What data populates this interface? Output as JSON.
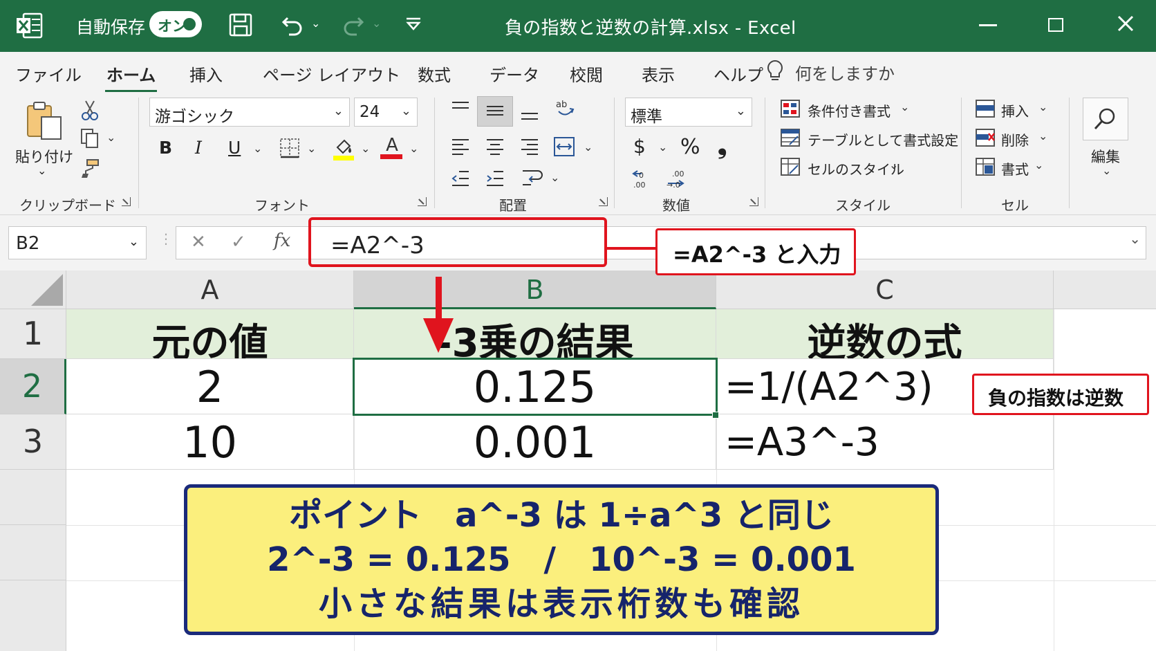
{
  "titlebar": {
    "autosave_label": "自動保存",
    "autosave_state": "オン",
    "document_title": "負の指数と逆数の計算.xlsx  -  Excel",
    "bg_color": "#1f6e43"
  },
  "menu": {
    "tabs": [
      "ファイル",
      "ホーム",
      "挿入",
      "ページ レイアウト",
      "数式",
      "データ",
      "校閲",
      "表示",
      "ヘルプ"
    ],
    "active_tab": "ホーム",
    "tell_me": "何をしますか"
  },
  "ribbon": {
    "clipboard": {
      "paste_label": "貼り付け",
      "group_label": "クリップボード"
    },
    "font": {
      "font_name": "游ゴシック",
      "font_size": "24",
      "bold": "B",
      "italic": "I",
      "underline": "U",
      "font_color_glyph": "A",
      "group_label": "フォント",
      "highlight_color": "#ffff00",
      "font_color": "#e0141e"
    },
    "alignment": {
      "group_label": "配置"
    },
    "number": {
      "format": "標準",
      "currency": "$",
      "percent": "%",
      "comma": "❟",
      "group_label": "数値"
    },
    "styles": {
      "conditional": "条件付き書式",
      "as_table": "テーブルとして書式設定",
      "cell_styles": "セルのスタイル",
      "group_label": "スタイル"
    },
    "cells": {
      "insert": "挿入",
      "delete": "削除",
      "format": "書式",
      "group_label": "セル"
    },
    "editing": {
      "label": "編集"
    }
  },
  "formula_bar": {
    "name_box": "B2",
    "cancel": "✕",
    "enter": "✓",
    "fx": "fx",
    "formula": "=A2^-3"
  },
  "sheet": {
    "columns": [
      "A",
      "B",
      "C"
    ],
    "rows": [
      "1",
      "2",
      "3"
    ],
    "header_fill": "#e2efda",
    "cells": {
      "A1": "元の値",
      "B1": "-3乗の結果",
      "C1": "逆数の式",
      "A2": "2",
      "B2": "0.125",
      "C2": "=1/(A2^3)",
      "A3": "10",
      "B3": "0.001",
      "C3": "=A3^-3"
    },
    "selected_cell": "B2"
  },
  "annotations": {
    "formula_callout": "=A2^-3 と入力",
    "inverse_callout": "負の指数は逆数",
    "point_lines": [
      "ポイント　a^-3 は 1÷a^3 と同じ",
      "2^-3 = 0.125　/　10^-3 = 0.001",
      "小さな結果は表示桁数も確認"
    ],
    "accent_red": "#e0141e",
    "point_bg": "#fbef7d",
    "point_text_color": "#16246b"
  }
}
